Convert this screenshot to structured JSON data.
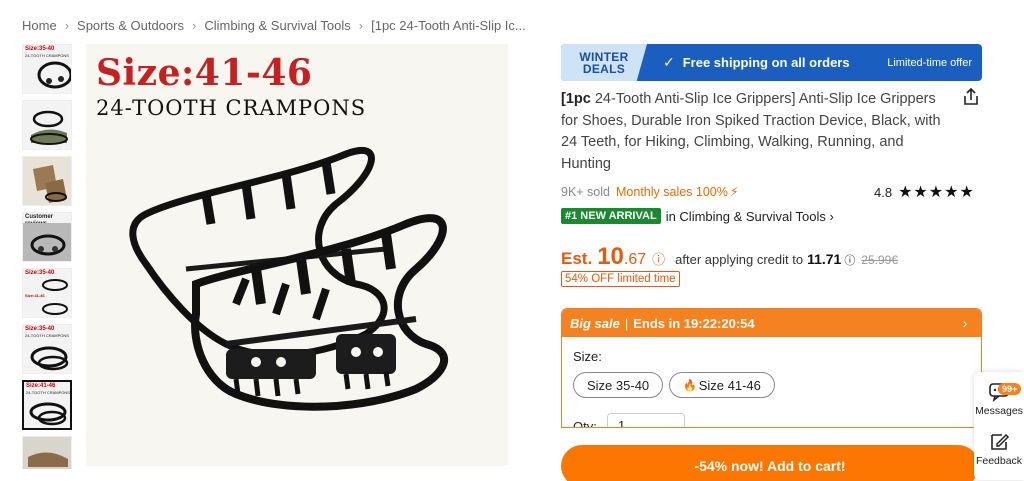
{
  "breadcrumb": {
    "items": [
      "Home",
      "Sports & Outdoors",
      "Climbing & Survival Tools",
      "[1pc 24-Tooth Anti-Slip Ic..."
    ]
  },
  "gallery": {
    "thumbnails": [
      {
        "label": "Size:35-40",
        "sub": "24-TOOTH CRAMPONS"
      },
      {
        "label": "",
        "sub": ""
      },
      {
        "label": "",
        "sub": ""
      },
      {
        "label": "Customer reviews",
        "sub": ""
      },
      {
        "label": "Size:35-40",
        "sub": "Size:41-46"
      },
      {
        "label": "Size:35-40",
        "sub": "24-TOOTH CRAMPONS"
      },
      {
        "label": "Size:41-46",
        "sub": "24-TOOTH CRAMPONS"
      },
      {
        "label": "",
        "sub": ""
      }
    ],
    "active_index": 6,
    "main_image": {
      "size_text": "Size:41-46",
      "sub_text": "24-TOOTH CRAMPONS"
    }
  },
  "promo": {
    "badge_line1": "WINTER",
    "badge_line2": "DEALS",
    "check_icon": "check-icon",
    "text": "Free shipping on all orders",
    "limited": "Limited-time offer",
    "color": "#1a5fbf"
  },
  "product": {
    "title_tag": "[1pc",
    "title_rest": " 24-Tooth Anti-Slip Ice Grippers] Anti-Slip Ice Grippers for Shoes, Durable Iron Spiked Traction Device, Black, with 24 Teeth, for Hiking, Climbing, Walking, Running, and Hunting",
    "sold": "9K+ sold",
    "monthly": "Monthly sales 100%",
    "monthly_icon": "⚡",
    "rating": "4.8",
    "stars": "★★★★★",
    "arrival_badge": "#1 NEW ARRIVAL",
    "arrival_category": "in Climbing & Survival Tools ›"
  },
  "price": {
    "est_label": "Est.",
    "integer": "10",
    "decimal": ".67",
    "info_icon": "ⓘ",
    "after_text": "after applying credit to",
    "credit_value": "11.71",
    "credit_icon": "ⓘ",
    "old_price": "25.99€",
    "off_badge": "54% OFF limited time",
    "accent": "#e8590c"
  },
  "sale": {
    "big_sale": "Big sale",
    "pipe": "|",
    "ends_text": "Ends in 19:22:20:54",
    "arrow": "›",
    "size_label": "Size:",
    "sizes": [
      "Size 35-40",
      "Size 41-46"
    ],
    "hot_icon": "🔥",
    "qty_label": "Qty:",
    "qty_value": "1"
  },
  "cart": {
    "label": "-54% now! Add to cart!",
    "color": "#fb7701"
  },
  "side_panel": {
    "messages_label": "Messages",
    "messages_badge": "99+",
    "feedback_label": "Feedback"
  }
}
